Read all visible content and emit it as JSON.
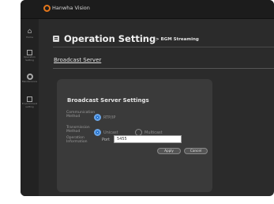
{
  "app": {
    "brand": "Hanwha Vision"
  },
  "sidebar": {
    "items": [
      {
        "icon": "home-icon",
        "label": "Home"
      },
      {
        "icon": "operation-setting-icon",
        "label": "Operation\nSetting"
      },
      {
        "icon": "maintenance-icon",
        "label": "Maintenance"
      },
      {
        "icon": "environment-setting-icon",
        "label": "Environment\nsetting"
      }
    ]
  },
  "header": {
    "title": "Operation Setting",
    "subtitle": "> BGM Streaming"
  },
  "section": {
    "tab_label": "Broadcast Server"
  },
  "panel": {
    "title": "Broadcast Server Settings",
    "communication_method": {
      "label": "Communication\nMethod",
      "option": "RTP/IP"
    },
    "transmission_method": {
      "label": "Transmission\nMethod",
      "options": [
        "Unicast",
        "Multicast"
      ],
      "selected": "Unicast"
    },
    "operation_information": {
      "label": "Operation\nInformation",
      "port_label": "Port",
      "port_value": "5455"
    },
    "buttons": {
      "apply": "Apply",
      "cancel": "Cancel"
    }
  },
  "colors": {
    "accent": "#2f7ad1",
    "brand": "#e4761b",
    "background": "#2b2b2b"
  }
}
